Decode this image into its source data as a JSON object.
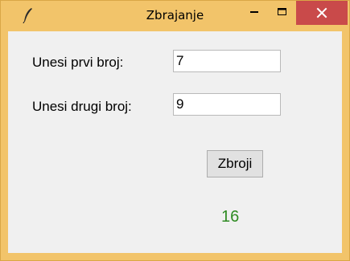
{
  "window": {
    "title": "Zbrajanje",
    "frame_color": "#f2c46a",
    "close_button_color": "#c94a4a"
  },
  "titlebar": {
    "app_icon": "feather-icon",
    "minimize_icon": "minimize-icon",
    "maximize_icon": "maximize-icon",
    "close_icon": "close-icon"
  },
  "form": {
    "first_label": "Unesi prvi broj:",
    "first_value": "7",
    "second_label": "Unesi drugi broj:",
    "second_value": "9",
    "button_label": "Zbroji"
  },
  "result": {
    "value": "16",
    "color": "#2e8b22"
  }
}
